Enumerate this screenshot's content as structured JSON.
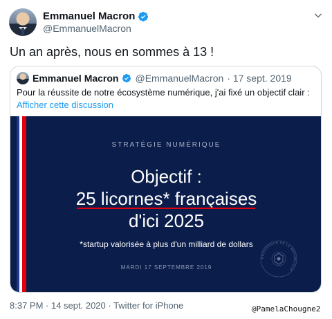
{
  "author": {
    "name": "Emmanuel Macron",
    "handle": "@EmmanuelMacron"
  },
  "tweet": {
    "text": "Un an après, nous en sommes à 13 !",
    "timestamp": "8:37 PM · 14 sept. 2020 · Twitter for iPhone"
  },
  "quoted": {
    "name": "Emmanuel Macron",
    "handle": "@EmmanuelMacron",
    "date": "· 17 sept. 2019",
    "text": "Pour la réussite de notre écosystème numérique, j'ai fixé un objectif clair :",
    "link": "Afficher cette discussion",
    "visual": {
      "kicker": "STRATÉGIE NUMÉRIQUE",
      "line1": "Objectif :",
      "line2": "25 licornes* françaises",
      "line3": "d'ici 2025",
      "footnote": "*startup valorisée à plus d'un milliard de dollars",
      "date": "MARDI 17 SEPTEMBRE 2019",
      "seal_text": "PRÉSIDENCE DE LA RÉPUBLIQUE"
    }
  },
  "watermark": "@PamelaChougne2",
  "colors": {
    "verified": "#1d9bf0",
    "link": "#1d9bf0",
    "navy": "#0b1d4a",
    "flag_red": "#e1000f"
  },
  "icons": [
    "verified-badge-icon",
    "chevron-down-icon",
    "seal-icon"
  ]
}
